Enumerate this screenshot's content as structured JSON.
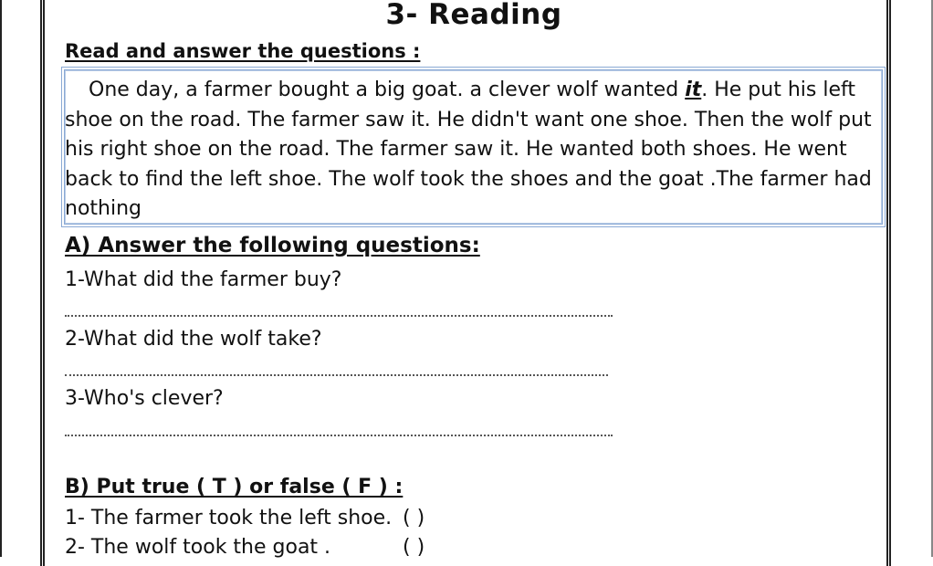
{
  "title": "3- Reading",
  "instruction": "Read and answer the questions :",
  "passage": {
    "before": "One day, a farmer bought a big goat. a clever wolf wanted ",
    "emphasis": "it",
    "after": ". He put his left shoe on the road. The farmer saw it. He didn't want one shoe. Then the wolf put his right shoe on the road. The farmer saw it. He wanted both shoes. He went back to find the left shoe. The wolf took the shoes and the goat .The farmer had nothing"
  },
  "section_a": {
    "heading": "A) Answer the following questions:",
    "questions": [
      "1-What did the farmer buy?",
      "2-What did the wolf take?",
      "3-Who's clever?"
    ]
  },
  "section_b": {
    "heading": "B) Put true ( T ) or false ( F ) :",
    "statements": [
      "1- The farmer took the left shoe.",
      "2- The wolf took the goat ."
    ],
    "answer_bracket": "(    )"
  }
}
